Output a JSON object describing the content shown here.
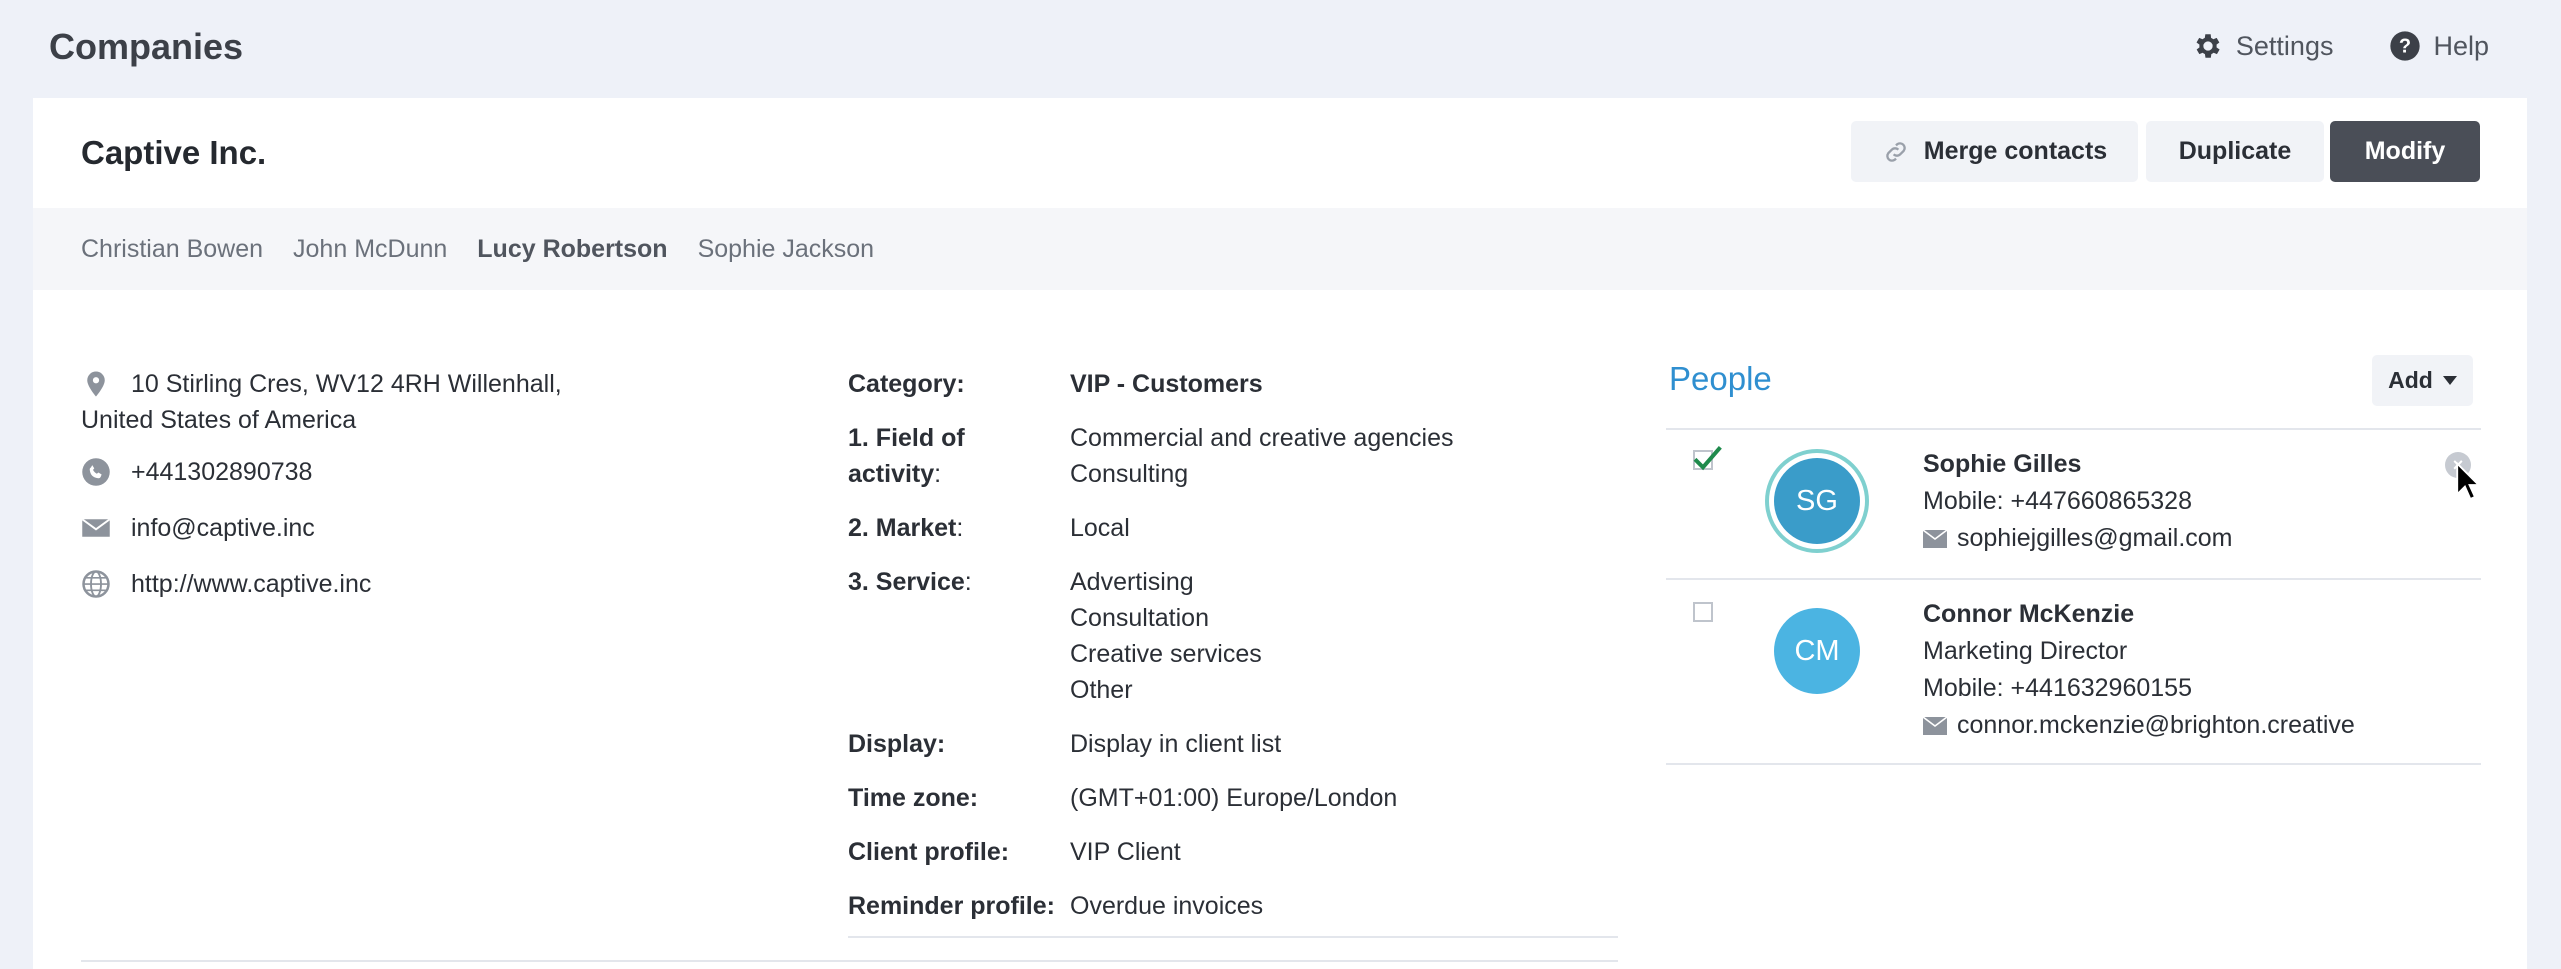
{
  "app": {
    "title": "Companies"
  },
  "top_actions": {
    "settings": "Settings",
    "help": "Help"
  },
  "company": {
    "name": "Captive Inc."
  },
  "buttons": {
    "merge": "Merge contacts",
    "duplicate": "Duplicate",
    "modify": "Modify"
  },
  "tabs": [
    {
      "label": "Christian Bowen",
      "active": false
    },
    {
      "label": "John McDunn",
      "active": false
    },
    {
      "label": "Lucy Robertson",
      "active": true
    },
    {
      "label": "Sophie Jackson",
      "active": false
    }
  ],
  "contact": {
    "address_line1": "10 Stirling Cres, WV12 4RH Willenhall,",
    "address_line2": "United States of America",
    "phone": "+441302890738",
    "email": "info@captive.inc",
    "website": "http://www.captive.inc"
  },
  "details": {
    "category": {
      "label": "Category:",
      "value": "VIP - Customers"
    },
    "field": {
      "label_a": "1. Field of",
      "label_b": "activity",
      "label_colon": ":",
      "values": [
        "Commercial and creative agencies",
        "Consulting"
      ]
    },
    "market": {
      "label_a": "2. Market",
      "label_colon": ":",
      "value": "Local"
    },
    "service": {
      "label_a": "3. Service",
      "label_colon": ":",
      "values": [
        "Advertising",
        "Consultation",
        "Creative services",
        "Other"
      ]
    },
    "display": {
      "label": "Display:",
      "value": "Display in client list"
    },
    "timezone": {
      "label": "Time zone:",
      "value": "(GMT+01:00) Europe/London"
    },
    "client_profile": {
      "label": "Client profile:",
      "value": "VIP Client"
    },
    "reminder_profile": {
      "label": "Reminder profile:",
      "value": "Overdue invoices"
    }
  },
  "people": {
    "title": "People",
    "add_label": "Add",
    "items": [
      {
        "initials": "SG",
        "name": "Sophie Gilles",
        "mobile": "Mobile: +447660865328",
        "email": "sophiejgilles@gmail.com",
        "checked": true
      },
      {
        "initials": "CM",
        "name": "Connor McKenzie",
        "role": "Marketing Director",
        "mobile": "Mobile: +441632960155",
        "email": "connor.mckenzie@brighton.creative",
        "checked": false
      }
    ]
  },
  "colors": {
    "accent": "#2f8fd0",
    "primary_button": "#4a4e57",
    "avatar": "#4bb4e2",
    "check": "#1f8a4c"
  }
}
